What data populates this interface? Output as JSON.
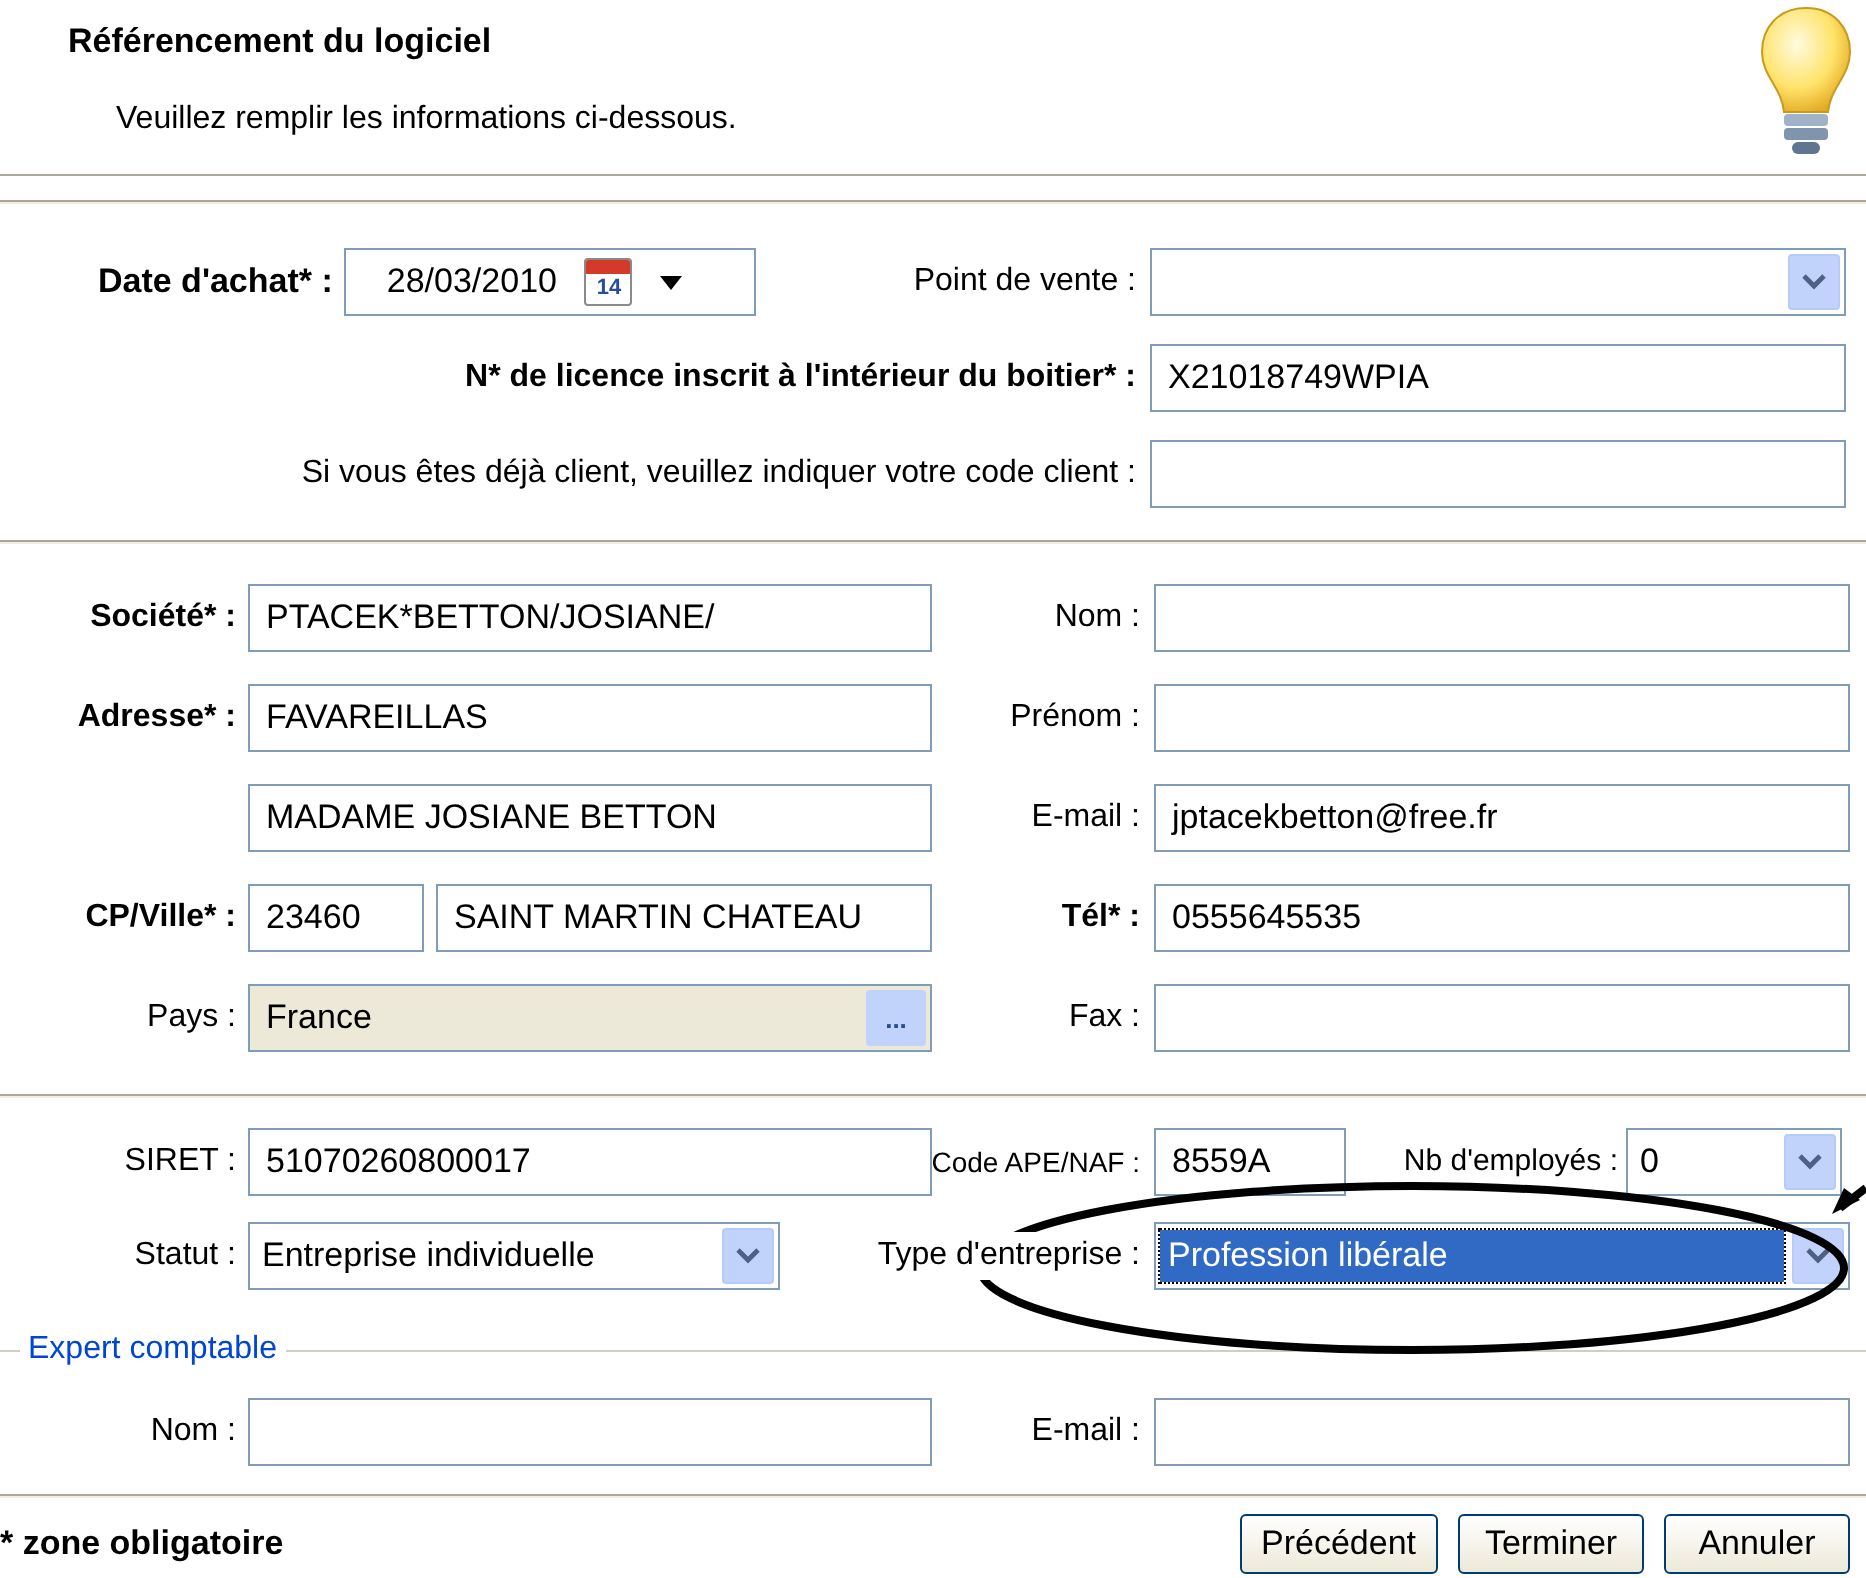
{
  "header": {
    "title": "Référencement du logiciel",
    "subtitle": "Veuillez remplir les informations ci-dessous."
  },
  "purchase": {
    "date": {
      "label": "Date d'achat* :",
      "value": "28/03/2010",
      "calendar_day": "14"
    },
    "point_of_sale": {
      "label": "Point de vente :",
      "kind": "select"
    },
    "licence": {
      "label": "N* de licence inscrit à l'intérieur du boitier* :",
      "value": "X21018749WPIA"
    },
    "client_code": {
      "label": "Si vous êtes déjà client, veuillez indiquer votre code client :"
    }
  },
  "company": {
    "left": [
      {
        "label": "Société* :",
        "required": true,
        "fields": [
          {
            "kind": "text",
            "value": "PTACEK*BETTON/JOSIANE/"
          }
        ]
      },
      {
        "label": "Adresse* :",
        "required": true,
        "fields": [
          {
            "kind": "text",
            "value": "FAVAREILLAS"
          }
        ]
      },
      {
        "fields": [
          {
            "kind": "text",
            "value": "MADAME JOSIANE BETTON"
          }
        ]
      },
      {
        "label": "CP/Ville* :",
        "required": true,
        "fields": [
          {
            "kind": "short",
            "value": "23460"
          },
          {
            "kind": "text",
            "value": "SAINT MARTIN CHATEAU"
          }
        ]
      },
      {
        "label": "Pays :",
        "required": false,
        "fields": [
          {
            "kind": "browse",
            "value": "France",
            "browse_label": "..."
          }
        ]
      }
    ],
    "right": [
      {
        "label": "Nom :",
        "required": false
      },
      {
        "label": "Prénom :",
        "required": false
      },
      {
        "label": "E-mail :",
        "required": false,
        "value": "jptacekbetton@free.fr"
      },
      {
        "label": "Tél* :",
        "required": true,
        "value": "0555645535"
      },
      {
        "label": "Fax :",
        "required": false
      }
    ]
  },
  "business": {
    "siret": {
      "label": "SIRET :",
      "value": "51070260800017"
    },
    "ape": {
      "label": "Code APE/NAF :",
      "value": "8559A"
    },
    "employees": {
      "label": "Nb d'employés :",
      "value": "0",
      "focused": false
    },
    "status": {
      "label": "Statut :",
      "value": "Entreprise individuelle",
      "focused": false
    },
    "company_type": {
      "label": "Type d'entreprise :",
      "value": "Profession libérale",
      "focused": true
    }
  },
  "accountant": {
    "legend": "Expert comptable",
    "name": {
      "label": "Nom :"
    },
    "email": {
      "label": "E-mail :"
    }
  },
  "footer": {
    "note": "* zone obligatoire",
    "buttons": [
      "Précédent",
      "Terminer",
      "Annuler"
    ]
  }
}
